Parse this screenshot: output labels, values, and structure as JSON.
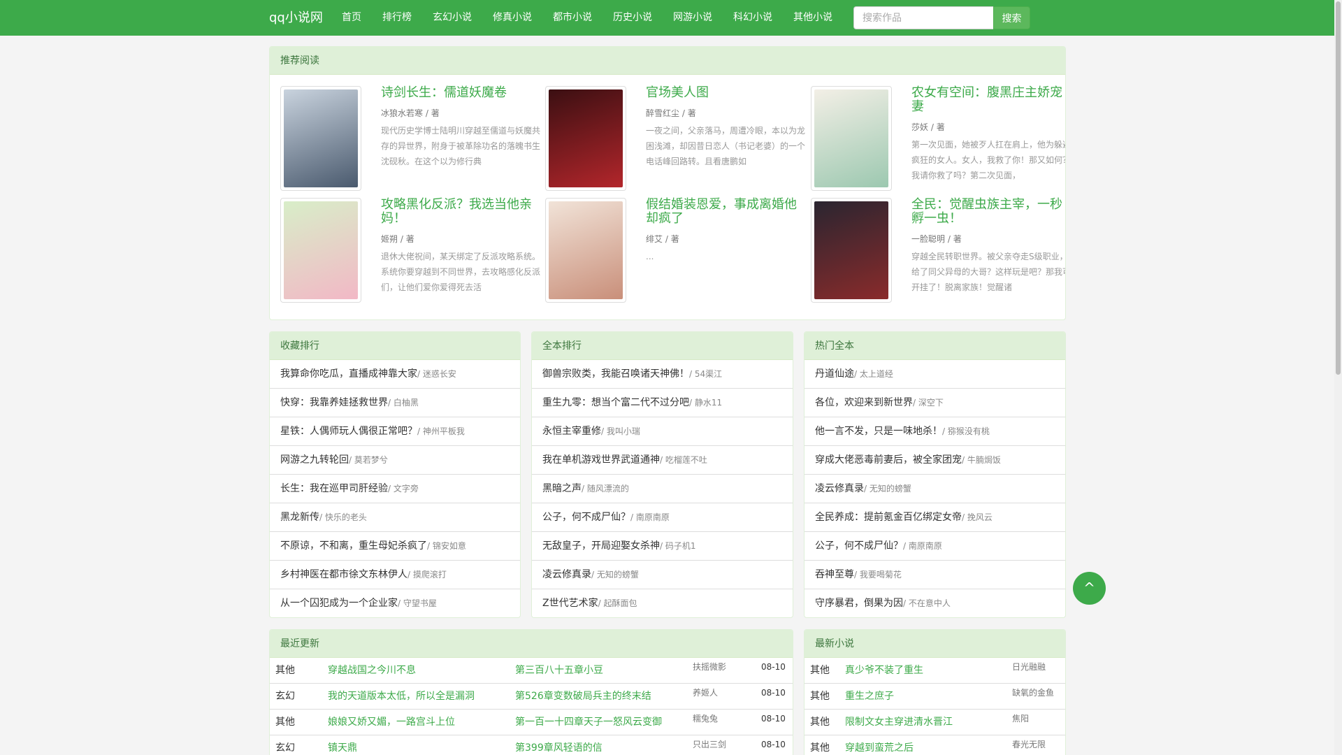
{
  "brand": "qq小说网",
  "nav": [
    "首页",
    "排行榜",
    "玄幻小说",
    "修真小说",
    "都市小说",
    "历史小说",
    "网游小说",
    "科幻小说",
    "其他小说"
  ],
  "search": {
    "placeholder": "搜索作品",
    "button": "搜索"
  },
  "recommend": {
    "title": "推荐阅读",
    "items": [
      {
        "title": "诗剑长生：儒道妖魔卷",
        "author": "冰狼水若寒",
        "by": "/ 著",
        "desc": "现代历史学博士陆明川穿越至儒道与妖魔共存的异世界，附身于被革除功名的落魄书生沈砚秋。在这个以为修行典",
        "cover_colors": [
          "#c9d3de",
          "#4a5a6e"
        ]
      },
      {
        "title": "官场美人图",
        "author": "醉雪红尘",
        "by": "/ 著",
        "desc": "一夜之间，父亲落马，周遭冷眼，本以为龙困浅滩，却因昔日恋人（书记老婆）的一个电话峰回路转。且看唐鹏如",
        "cover_colors": [
          "#3b0f12",
          "#b3262b"
        ]
      },
      {
        "title": "农女有空间：腹黑庄主娇宠妻",
        "author": "莎妖",
        "by": "/ 著",
        "desc": "第一次见面，她被歹人扛在肩上，他为躲避疯狂的女人。女人，我救了你！那又如何？我请你救了吗？第二次见面，",
        "cover_colors": [
          "#f3efe6",
          "#9cc8b0"
        ]
      },
      {
        "title": "攻略黑化反派？我选当他亲妈！",
        "author": "姬朔",
        "by": "/ 著",
        "desc": "退休大佬祝间，某天绑定了反派攻略系统。系统你要穿越到不同世界，去攻略感化反派们，让他们爱你爱得死去活",
        "cover_colors": [
          "#d8eec8",
          "#f2b8c6"
        ]
      },
      {
        "title": "假结婚装恩爱，事成离婚他却疯了",
        "author": "绯艾",
        "by": "/ 著",
        "desc": "...",
        "cover_colors": [
          "#f1e3d8",
          "#c98f7a"
        ]
      },
      {
        "title": "全民：觉醒虫族主宰，一秒孵一虫！",
        "author": "一脸聪明",
        "by": "/ 著",
        "desc": "穿越全民转职世界。被父亲夺走S级职业，给了同父异母的大哥？这样玩是吧？那我可开挂了！脱离家族！觉醒诸",
        "cover_colors": [
          "#2a2530",
          "#8a2b2b"
        ]
      }
    ]
  },
  "lists": [
    {
      "title": "收藏排行",
      "items": [
        {
          "title": "我算命你吃瓜，直播成神靠大家",
          "author": "/ 迷惑长安"
        },
        {
          "title": "快穿：我靠养娃拯救世界",
          "author": "/ 白柚黑"
        },
        {
          "title": "星铁：人偶师玩人偶很正常吧？",
          "author": "/ 神州平板我"
        },
        {
          "title": "网游之九转轮回",
          "author": "/ 莫若梦兮"
        },
        {
          "title": "长生：我在巡甲司肝经验",
          "author": "/ 文字旁"
        },
        {
          "title": "黑龙新传",
          "author": "/ 快乐的老头"
        },
        {
          "title": "不原谅，不和离，重生母妃杀疯了",
          "author": "/ 锦安如意"
        },
        {
          "title": "乡村神医在都市徐文东林伊人",
          "author": "/ 摸爬滚打"
        },
        {
          "title": "从一个囚犯成为一个企业家",
          "author": "/ 守望书屋"
        }
      ]
    },
    {
      "title": "全本排行",
      "items": [
        {
          "title": "御兽宗败类，我能召唤诸天神佛！",
          "author": "/ 54渠江"
        },
        {
          "title": "重生九零：想当个富二代不过分吧",
          "author": "/ 静水11"
        },
        {
          "title": "永恒主宰重修",
          "author": "/ 我叫小瑞"
        },
        {
          "title": "我在单机游戏世界武道通神",
          "author": "/ 吃榴莲不吐"
        },
        {
          "title": "黑暗之声",
          "author": "/ 随风漂流的"
        },
        {
          "title": "公子，何不成尸仙？",
          "author": "/ 南原南原"
        },
        {
          "title": "无敌皇子，开局迎娶女杀神",
          "author": "/ 码子机1"
        },
        {
          "title": "凌云修真录",
          "author": "/ 无知的螃蟹"
        },
        {
          "title": "Z世代艺术家",
          "author": "/ 起酥面包"
        }
      ]
    },
    {
      "title": "热门全本",
      "items": [
        {
          "title": "丹道仙途",
          "author": "/ 太上道经"
        },
        {
          "title": "各位，欢迎来到新世界",
          "author": "/ 深空下"
        },
        {
          "title": "他一言不发，只是一味地杀！",
          "author": "/ 猕猴没有桃"
        },
        {
          "title": "穿成大佬恶毒前妻后，被全家团宠",
          "author": "/ 牛腩焗饭"
        },
        {
          "title": "凌云修真录",
          "author": "/ 无知的螃蟹"
        },
        {
          "title": "全民养成：提前氪金百亿绑定女帝",
          "author": "/ 挽风云"
        },
        {
          "title": "公子，何不成尸仙？",
          "author": "/ 南原南原"
        },
        {
          "title": "吞神至尊",
          "author": "/ 我要喝菊花"
        },
        {
          "title": "守序暴君，倒果为因",
          "author": "/ 不在意中人"
        }
      ]
    }
  ],
  "updates": {
    "title": "最近更新",
    "rows": [
      {
        "cat": "其他",
        "book": "穿越战国之今川不息",
        "chapter": "第三百八十五章小豆",
        "author": "扶摇微影",
        "date": "08-10"
      },
      {
        "cat": "玄幻",
        "book": "我的天道版本太低，所以全是漏洞",
        "chapter": "第526章变数破局兵主的终末结",
        "author": "养姬人",
        "date": "08-10"
      },
      {
        "cat": "其他",
        "book": "娘娘又娇又媚，一路宫斗上位",
        "chapter": "第一百一十四章天子一怒风云变御",
        "author": "糯兔兔",
        "date": "08-10"
      },
      {
        "cat": "玄幻",
        "book": "镇天鼎",
        "chapter": "第399章风轻语的信",
        "author": "只出三剑",
        "date": "08-10"
      }
    ]
  },
  "newest": {
    "title": "最新小说",
    "rows": [
      {
        "cat": "其他",
        "book": "真少爷不装了重生",
        "author": "日光融融"
      },
      {
        "cat": "其他",
        "book": "重生之庶子",
        "author": "缺氧的金鱼"
      },
      {
        "cat": "其他",
        "book": "限制文女主穿进清水晋江",
        "author": "焦阳"
      },
      {
        "cat": "其他",
        "book": "穿越到蛮荒之后",
        "author": "春光无限"
      }
    ]
  },
  "back_to_top": "^"
}
